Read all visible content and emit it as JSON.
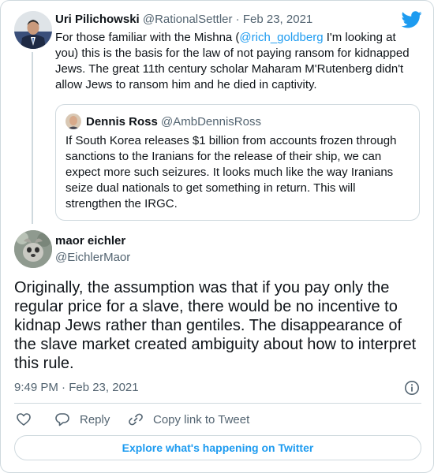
{
  "original_tweet": {
    "author_name": "Uri Pilichowski",
    "author_handle": "@RationalSettler",
    "separator": "·",
    "date": "Feb 23, 2021",
    "text_before_mention": "For those familiar with the Mishna (",
    "mention": "@rich_goldberg",
    "text_after_mention": " I'm looking at you) this is the basis for the law of not paying ransom for kidnapped Jews. The great 11th century scholar Maharam M'Rutenberg didn't allow Jews to ransom him and he died in captivity."
  },
  "quoted_tweet": {
    "author_name": "Dennis Ross",
    "author_handle": "@AmbDennisRoss",
    "text": "If South Korea releases $1 billion from accounts frozen through sanctions to the Iranians for the release of their ship, we can expect more such seizures. It looks much like the way Iranians seize dual nationals to get something in return. This will strengthen the IRGC."
  },
  "main_tweet": {
    "author_name": "maor eichler",
    "author_handle": "@EichlerMaor",
    "text": "Originally, the assumption was that if you pay only the regular price for a slave, there would be no incentive to kidnap Jews rather than gentiles. The disappearance of the slave market created ambiguity about how to interpret this rule.",
    "timestamp": "9:49 PM · Feb 23, 2021"
  },
  "actions": {
    "reply_label": "Reply",
    "copy_link_label": "Copy link to Tweet"
  },
  "footer": {
    "explore_label": "Explore what's happening on Twitter"
  },
  "icons": {
    "brand": "twitter-bird-icon",
    "heart": "heart-icon",
    "reply": "reply-icon",
    "link": "link-icon",
    "info": "info-icon"
  },
  "colors": {
    "accent": "#1d9bf0",
    "muted_text": "#536471",
    "border": "#cfd9de",
    "text": "#0f1419"
  }
}
